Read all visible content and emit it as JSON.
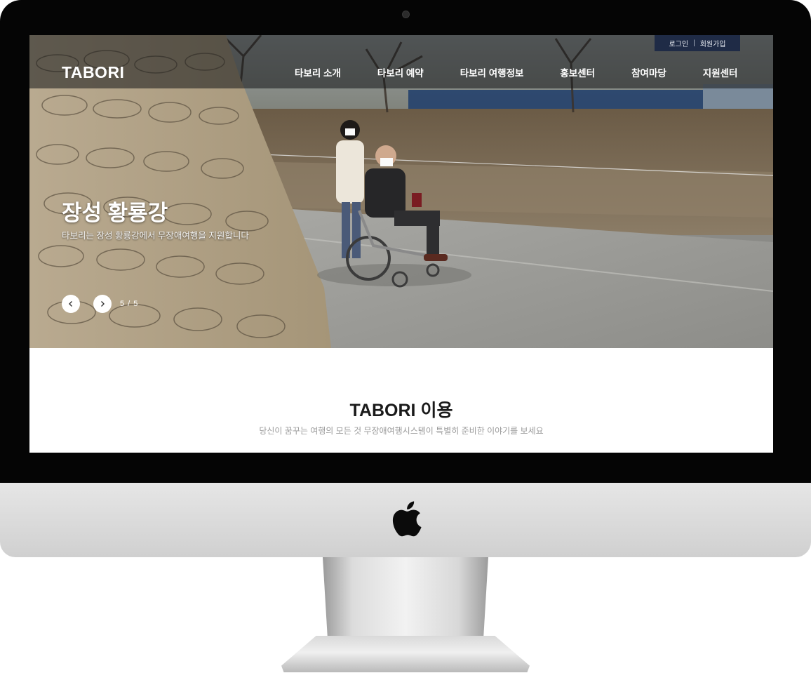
{
  "header": {
    "logo": "TABORI",
    "util_links": {
      "login": "로그인",
      "separator": "|",
      "signup": "회원가입"
    },
    "nav": [
      {
        "label": "타보리 소개"
      },
      {
        "label": "타보리 예약"
      },
      {
        "label": "타보리 여행정보"
      },
      {
        "label": "홍보센터"
      },
      {
        "label": "참여마당"
      },
      {
        "label": "지원센터"
      }
    ]
  },
  "hero": {
    "title": "장성 황룡강",
    "description": "타보리는 장성 황룡강에서 무장애여행을 지원합니다",
    "counter": "5 / 5"
  },
  "section": {
    "title": "TABORI 이용",
    "subtitle": "당신이 꿈꾸는 여행의 모든 것 무장애여행시스템이 특별히 준비한 이야기를 보세요"
  },
  "colors": {
    "util_bar": "#1f2b46",
    "bezel": "#050505",
    "chin": "#d8d8d8"
  }
}
